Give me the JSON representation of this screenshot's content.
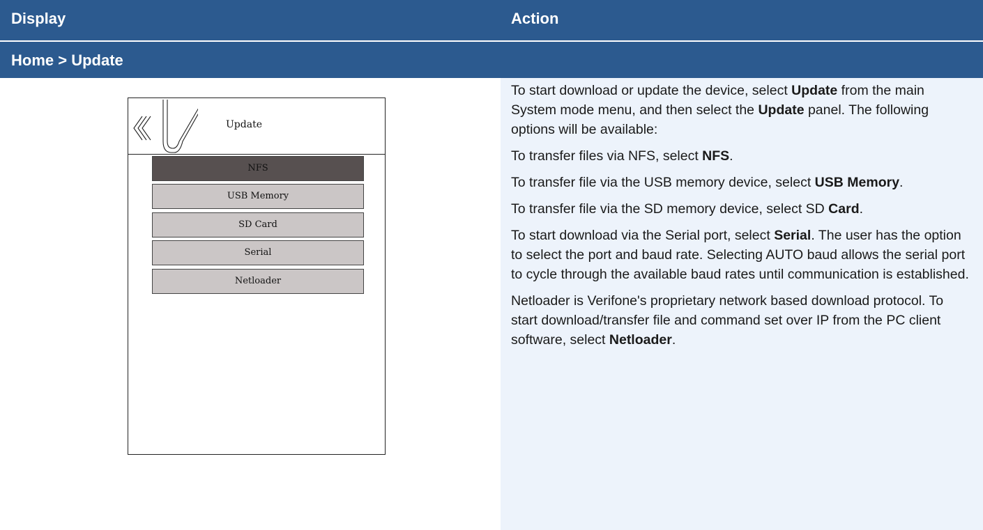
{
  "header": {
    "display_label": "Display",
    "action_label": "Action",
    "breadcrumb": "Home > Update"
  },
  "screen": {
    "title": "Update",
    "logo_icon": "verifone-back-logo-icon",
    "menu": [
      {
        "label": "NFS",
        "selected": true
      },
      {
        "label": "USB Memory",
        "selected": false
      },
      {
        "label": "SD Card",
        "selected": false
      },
      {
        "label": "Serial",
        "selected": false
      },
      {
        "label": "Netloader",
        "selected": false
      }
    ]
  },
  "action": {
    "p1_a": "To start download or update the device, select ",
    "p1_b": "Update",
    "p1_c": " from the main System mode menu, and then select the ",
    "p1_d": "Update",
    "p1_e": " panel. The following options will be available:",
    "p2_a": "To transfer files via NFS, select ",
    "p2_b": "NFS",
    "p2_c": ".",
    "p3_a": "To transfer file via the USB memory device, select ",
    "p3_b": "USB Memory",
    "p3_c": ".",
    "p4_a": "To transfer file via the SD memory device, select SD ",
    "p4_b": "Card",
    "p4_c": ".",
    "p5_a": "To start download via the Serial port, select ",
    "p5_b": "Serial",
    "p5_c": ". The user has the option to select the port and baud rate. Selecting AUTO baud allows the serial port to cycle through the available baud rates until communication is established.",
    "p6_a": "Netloader is Verifone's proprietary network based download protocol. To start download/transfer file and command set over IP from the PC client software, select ",
    "p6_b": "Netloader",
    "p6_c": "."
  }
}
